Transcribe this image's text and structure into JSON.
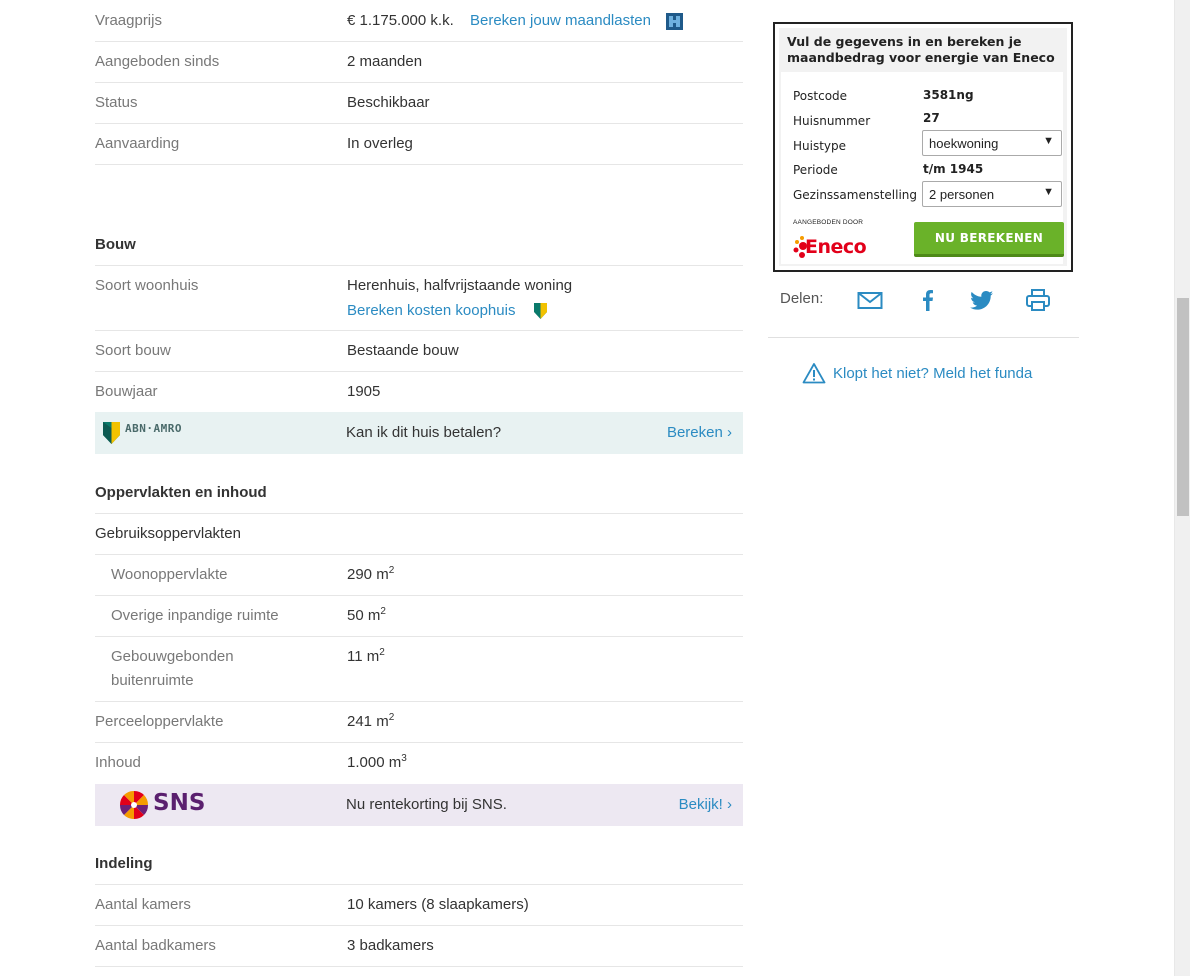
{
  "rows_top": [
    {
      "label": "Vraagprijs",
      "value": "€ 1.175.000 k.k.",
      "link": "Bereken jouw maandlasten"
    },
    {
      "label": "Aangeboden sinds",
      "value": "2 maanden"
    },
    {
      "label": "Status",
      "value": "Beschikbaar"
    },
    {
      "label": "Aanvaarding",
      "value": "In overleg"
    }
  ],
  "bouw": {
    "heading": "Bouw",
    "soort_woonhuis_label": "Soort woonhuis",
    "soort_woonhuis_value": "Herenhuis, halfvrijstaande woning",
    "kosten_link": "Bereken kosten koophuis",
    "soort_bouw_label": "Soort bouw",
    "soort_bouw_value": "Bestaande bouw",
    "bouwjaar_label": "Bouwjaar",
    "bouwjaar_value": "1905"
  },
  "abn": {
    "brand": "ABN·AMRO",
    "text": "Kan ik dit huis betalen?",
    "cta": "Bereken ›",
    "bg_color": "#e8f2f2"
  },
  "oppervlakten": {
    "heading": "Oppervlakten en inhoud",
    "gebruik_label": "Gebruiksoppervlakten",
    "woon_label": "Woonoppervlakte",
    "woon_value": "290 m",
    "overig_label": "Overige inpandige ruimte",
    "overig_value": "50 m",
    "gebouw_label_1": "Gebouwgebonden",
    "gebouw_label_2": "buitenruimte",
    "gebouw_value": "11 m",
    "perceel_label": "Perceeloppervlakte",
    "perceel_value": "241 m",
    "inhoud_label": "Inhoud",
    "inhoud_value": "1.000 m",
    "sup2": "2",
    "sup3": "3"
  },
  "sns": {
    "brand": "SNS",
    "text": "Nu rentekorting bij SNS.",
    "cta": "Bekijk! ›",
    "bg_color": "#ede8f2"
  },
  "indeling": {
    "heading": "Indeling",
    "kamers_label": "Aantal kamers",
    "kamers_value": "10 kamers (8 slaapkamers)",
    "badkamers_label": "Aantal badkamers",
    "badkamers_value": "3 badkamers"
  },
  "eneco": {
    "title": "Vul de gegevens in en bereken je maandbedrag voor energie van Eneco",
    "postcode_label": "Postcode",
    "postcode_value": "3581ng",
    "huisnummer_label": "Huisnummer",
    "huisnummer_value": "27",
    "huistype_label": "Huistype",
    "huistype_value": "hoekwoning",
    "periode_label": "Periode",
    "periode_value": "t/m 1945",
    "gezin_label": "Gezinssamenstelling",
    "gezin_value": "2 personen",
    "offered_by": "AANGEBODEN DOOR",
    "logo_text": "Eneco",
    "button": "NU BEREKENEN",
    "button_color": "#6ab229"
  },
  "share": {
    "label": "Delen:",
    "icons": [
      "mail-icon",
      "facebook-icon",
      "twitter-icon",
      "print-icon"
    ]
  },
  "report": {
    "text": "Klopt het niet? Meld het funda"
  },
  "colors": {
    "link": "#2b8bc2",
    "label": "#787878",
    "divider": "#e6e6e6"
  }
}
